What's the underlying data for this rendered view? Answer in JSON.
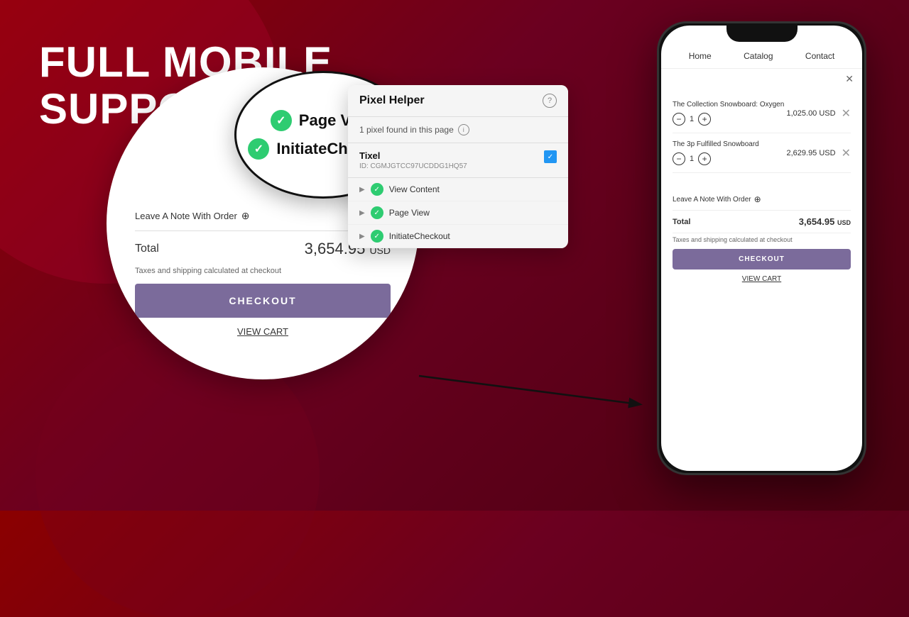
{
  "hero": {
    "line1": "FULL MOBILE",
    "line2": "SUPPORT"
  },
  "phone": {
    "nav": {
      "home": "Home",
      "catalog": "Catalog",
      "contact": "Contact"
    },
    "items": [
      {
        "name": "The Collection Snowboard: Oxygen",
        "qty": 1,
        "price": "1,025.00 USD"
      },
      {
        "name": "The 3p Fulfilled Snowboard",
        "qty": 1,
        "price": "2,629.95 USD"
      }
    ],
    "note_label": "Leave A Note With Order",
    "total_label": "Total",
    "total_amount": "3,654.95",
    "total_currency": "USD",
    "taxes_note": "Taxes and shipping calculated at checkout",
    "checkout_label": "CHECKOUT",
    "view_cart_label": "VIEW CART"
  },
  "circle": {
    "note_label": "Leave A Note With Order",
    "total_label": "Total",
    "total_amount": "3,654.95",
    "total_currency": "USD",
    "taxes_note": "Taxes and shipping calculated at checkout",
    "checkout_label": "CHECKOUT",
    "view_cart_label": "VIEW CART"
  },
  "zoom_bubble": {
    "item1": "Page View",
    "item2": "InitiateCheckout"
  },
  "pixel_helper": {
    "title": "Pixel Helper",
    "subtext": "1 pixel found in this page",
    "pixel_name": "Tixel",
    "pixel_id": "ID: CGMJGTCC97UCDDG1HQ57",
    "events": [
      "View Content",
      "Page View",
      "InitiateCheckout"
    ]
  }
}
